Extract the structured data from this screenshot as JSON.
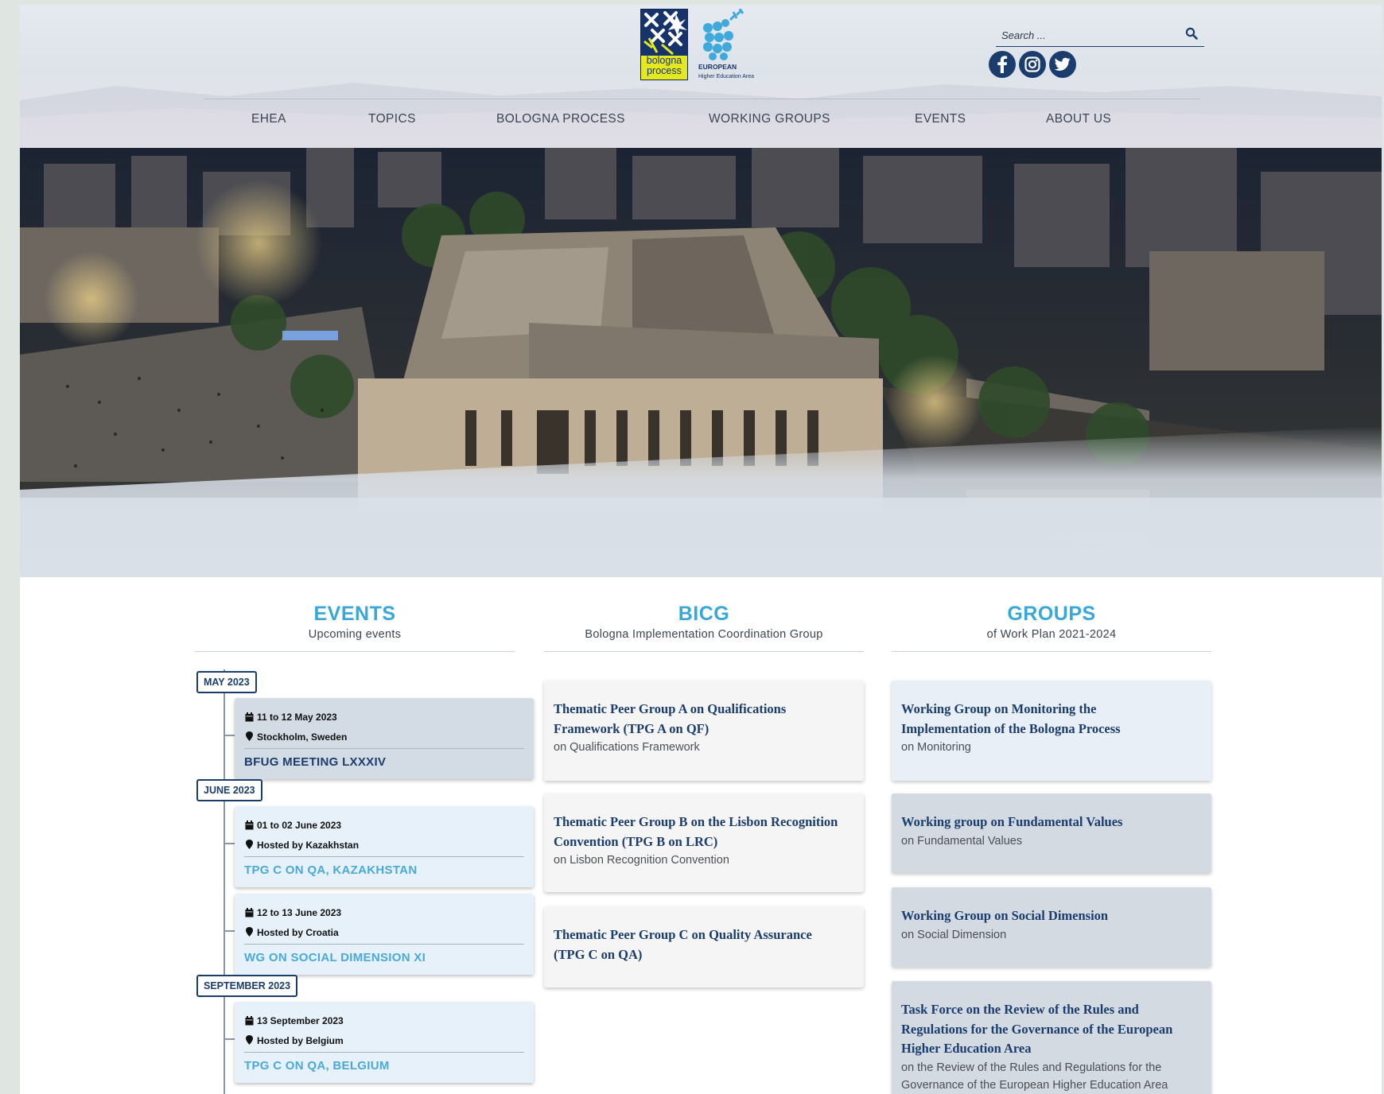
{
  "header": {
    "logo_left_text": [
      "bologna",
      "process"
    ],
    "logo_right_text": [
      "EUROPEAN",
      "Higher Education Area"
    ],
    "search_placeholder": "Search ...",
    "social": [
      "facebook-icon",
      "instagram-icon",
      "twitter-icon"
    ],
    "nav": [
      "EHEA",
      "TOPICS",
      "BOLOGNA PROCESS",
      "WORKING GROUPS",
      "EVENTS",
      "ABOUT US"
    ]
  },
  "events": {
    "title": "EVENTS",
    "subtitle": "Upcoming events",
    "months": [
      "MAY 2023",
      "JUNE 2023",
      "SEPTEMBER 2023"
    ],
    "items": [
      {
        "date": "11 to 12 May 2023",
        "place": "Stockholm, Sweden",
        "title": "BFUG MEETING LXXXIV"
      },
      {
        "date": "01 to 02 June 2023",
        "place": "Hosted by Kazakhstan",
        "title": "TPG C ON QA, KAZAKHSTAN"
      },
      {
        "date": "12 to 13 June 2023",
        "place": "Hosted by Croatia",
        "title": "WG ON SOCIAL DIMENSION XI"
      },
      {
        "date": "13 September 2023",
        "place": "Hosted by Belgium",
        "title": "TPG C ON QA, BELGIUM"
      }
    ]
  },
  "bicg": {
    "title": "BICG",
    "subtitle": "Bologna Implementation Coordination Group",
    "items": [
      {
        "title_lines": [
          "Thematic Peer Group A on Qualifications",
          "Framework (TPG A on QF)"
        ],
        "sub": "on Qualifications Framework"
      },
      {
        "title_lines": [
          "Thematic Peer Group B on the Lisbon Recognition",
          "Convention (TPG B on LRC)"
        ],
        "sub": "on Lisbon Recognition Convention"
      },
      {
        "title_lines": [
          "Thematic Peer Group C on Quality Assurance",
          "(TPG C on QA)"
        ],
        "sub": ""
      }
    ]
  },
  "groups": {
    "title": "GROUPS",
    "subtitle": "of Work Plan 2021-2024",
    "items": [
      {
        "title_lines": [
          "Working Group on Monitoring the",
          "Implementation of the Bologna Process"
        ],
        "sub": "on Monitoring"
      },
      {
        "title_lines": [
          "Working group on Fundamental Values"
        ],
        "sub": "on Fundamental Values"
      },
      {
        "title_lines": [
          "Working Group on Social Dimension"
        ],
        "sub": "on Social Dimension"
      },
      {
        "title_lines": [
          "Task Force on the Review of the Rules and",
          "Regulations for the Governance of the European",
          "Higher Education Area"
        ],
        "sub_lines": [
          "on the Review of the Rules and Regulations for the",
          "Governance of the European Higher Education Area"
        ]
      }
    ]
  },
  "colors": {
    "accent": "#38a8d8",
    "navy": "#1b3d6e",
    "link_light": "#4aa9d6"
  }
}
